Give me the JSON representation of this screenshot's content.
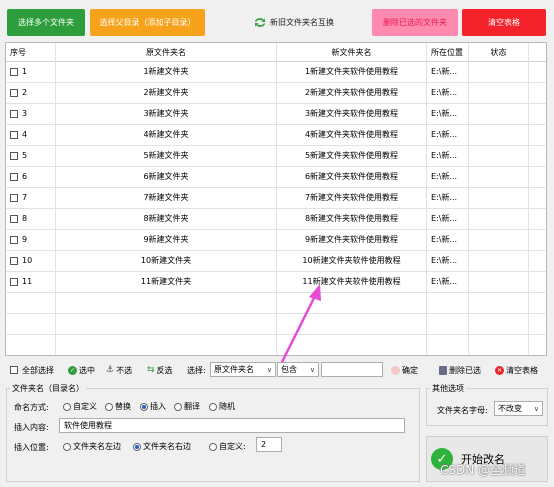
{
  "top_buttons": {
    "select_multi": "选择多个文件夹",
    "select_parent": "选择父目录（添加子目录）",
    "swap": "新旧文件夹名互换",
    "delete_selected": "删除已选的文件夹",
    "clear": "清空表格"
  },
  "colors": {
    "green": "#2e9e3c",
    "orange": "#f6a31b",
    "pink": "#ff8ab0",
    "red": "#f3222b",
    "arrow": "#e84bd8"
  },
  "table": {
    "columns": [
      "序号",
      "原文件夹名",
      "新文件夹名",
      "所在位置",
      "状态"
    ],
    "rows": [
      {
        "no": "1",
        "old": "1新建文件夹",
        "new": "1新建文件夹软件使用教程",
        "loc": "E:\\新...",
        "status": ""
      },
      {
        "no": "2",
        "old": "2新建文件夹",
        "new": "2新建文件夹软件使用教程",
        "loc": "E:\\新...",
        "status": ""
      },
      {
        "no": "3",
        "old": "3新建文件夹",
        "new": "3新建文件夹软件使用教程",
        "loc": "E:\\新...",
        "status": ""
      },
      {
        "no": "4",
        "old": "4新建文件夹",
        "new": "4新建文件夹软件使用教程",
        "loc": "E:\\新...",
        "status": ""
      },
      {
        "no": "5",
        "old": "5新建文件夹",
        "new": "5新建文件夹软件使用教程",
        "loc": "E:\\新...",
        "status": ""
      },
      {
        "no": "6",
        "old": "6新建文件夹",
        "new": "6新建文件夹软件使用教程",
        "loc": "E:\\新...",
        "status": ""
      },
      {
        "no": "7",
        "old": "7新建文件夹",
        "new": "7新建文件夹软件使用教程",
        "loc": "E:\\新...",
        "status": ""
      },
      {
        "no": "8",
        "old": "8新建文件夹",
        "new": "8新建文件夹软件使用教程",
        "loc": "E:\\新...",
        "status": ""
      },
      {
        "no": "9",
        "old": "9新建文件夹",
        "new": "9新建文件夹软件使用教程",
        "loc": "E:\\新...",
        "status": ""
      },
      {
        "no": "10",
        "old": "10新建文件夹",
        "new": "10新建文件夹软件使用教程",
        "loc": "E:\\新...",
        "status": ""
      },
      {
        "no": "11",
        "old": "11新建文件夹",
        "new": "11新建文件夹软件使用教程",
        "loc": "E:\\新...",
        "status": ""
      }
    ]
  },
  "toolbar": {
    "select_all": "全部选择",
    "check": "选中",
    "uncheck": "不选",
    "invert": "反选",
    "select_label": "选择:",
    "field_select": "原文件夹名",
    "match_select": "包含",
    "filter_value": "",
    "confirm": "确定",
    "delete_selected": "删除已选",
    "clear_table": "清空表格"
  },
  "rename_panel": {
    "title": "文件夹名（目录名）",
    "mode_label": "命名方式:",
    "modes": [
      "自定义",
      "替换",
      "插入",
      "翻译",
      "随机"
    ],
    "selected_mode": "插入",
    "content_label": "插入内容:",
    "content_value": "软件使用教程",
    "position_label": "插入位置:",
    "positions": [
      "文件夹名左边",
      "文件夹名右边",
      "自定义:"
    ],
    "selected_position": "文件夹名右边",
    "custom_value": "2"
  },
  "other_panel": {
    "title": "其他选项",
    "case_label": "文件夹名字母:",
    "case_value": "不改变"
  },
  "start_button": "开始改名",
  "watermark": "CSDN @全频道"
}
